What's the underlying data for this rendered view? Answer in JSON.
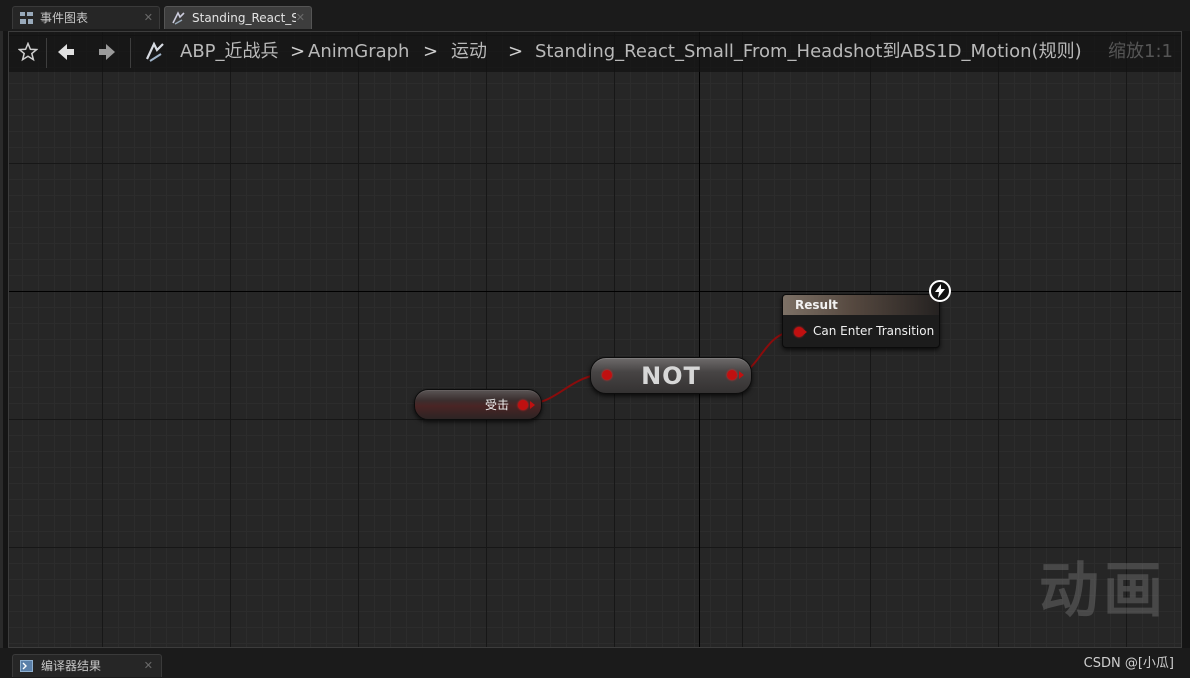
{
  "tabs": [
    {
      "label": "事件图表",
      "icon": "event-graph-icon",
      "close": "✕"
    },
    {
      "label": "Standing_React_Sr",
      "icon": "transition-rule-icon",
      "close": "✕"
    }
  ],
  "breadcrumb": {
    "items": [
      "ABP_近战兵",
      "AnimGraph",
      "运动",
      "Standing_React_Small_From_Headshot到ABS1D_Motion(规则)"
    ],
    "separator": ">"
  },
  "zoom_label": "缩放1:1",
  "nodes": {
    "variable": {
      "label": "受击"
    },
    "not": {
      "label": "NOT"
    },
    "result": {
      "title": "Result",
      "pin_label": "Can Enter Transition"
    }
  },
  "watermark": "动画",
  "bottom_tab": {
    "label": "编译器结果",
    "icon": "compiler-results-icon",
    "close": "✕"
  },
  "credit": "CSDN @[小瓜]",
  "colors": {
    "bool_pin": "#c01010",
    "grid_bg": "#262626",
    "result_header": "#7d7166"
  }
}
